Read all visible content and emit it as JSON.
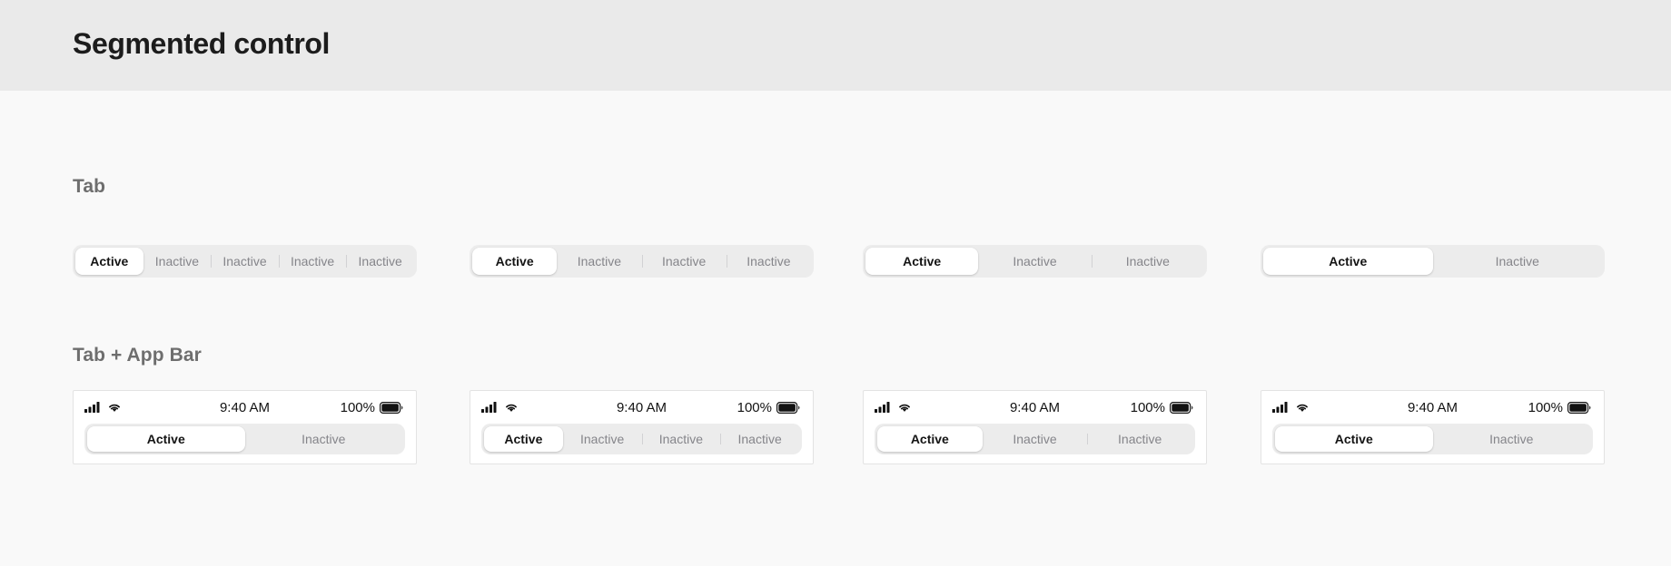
{
  "header": {
    "title": "Segmented control",
    "background": "#eaeaea"
  },
  "canvas": {
    "background": "#f9f9f9"
  },
  "sections": {
    "tab": {
      "label": "Tab"
    },
    "tab_app_bar": {
      "label": "Tab + App Bar"
    }
  },
  "colors": {
    "track": "#ececec",
    "thumb": "#ffffff",
    "active_text": "#141414",
    "inactive_text": "#85858a",
    "divider": "#d2d2d4",
    "section_label": "#6e6e6e",
    "card_border": "#e3e3e3"
  },
  "labels": {
    "active": "Active",
    "inactive": "Inactive"
  },
  "tab_row": {
    "controls": [
      {
        "name": "five-segment-control",
        "segments": [
          {
            "label": "Active",
            "state": "active"
          },
          {
            "label": "Inactive",
            "state": "inactive"
          },
          {
            "label": "Inactive",
            "state": "inactive"
          },
          {
            "label": "Inactive",
            "state": "inactive"
          },
          {
            "label": "Inactive",
            "state": "inactive"
          }
        ]
      },
      {
        "name": "four-segment-control",
        "segments": [
          {
            "label": "Active",
            "state": "active"
          },
          {
            "label": "Inactive",
            "state": "inactive"
          },
          {
            "label": "Inactive",
            "state": "inactive"
          },
          {
            "label": "Inactive",
            "state": "inactive"
          }
        ]
      },
      {
        "name": "three-segment-control",
        "segments": [
          {
            "label": "Active",
            "state": "active"
          },
          {
            "label": "Inactive",
            "state": "inactive"
          },
          {
            "label": "Inactive",
            "state": "inactive"
          }
        ]
      },
      {
        "name": "two-segment-control",
        "segments": [
          {
            "label": "Active",
            "state": "active"
          },
          {
            "label": "Inactive",
            "state": "inactive"
          }
        ]
      }
    ]
  },
  "app_bar_row": {
    "status_bar": {
      "time": "9:40 AM",
      "battery_percent": "100%",
      "icons": [
        "signal-bars-icon",
        "wifi-icon",
        "battery-icon"
      ]
    },
    "cards": [
      {
        "name": "app-bar-card-two-segments",
        "segments": [
          {
            "label": "Active",
            "state": "active"
          },
          {
            "label": "Inactive",
            "state": "inactive"
          }
        ]
      },
      {
        "name": "app-bar-card-four-segments",
        "segments": [
          {
            "label": "Active",
            "state": "active"
          },
          {
            "label": "Inactive",
            "state": "inactive"
          },
          {
            "label": "Inactive",
            "state": "inactive"
          },
          {
            "label": "Inactive",
            "state": "inactive"
          }
        ]
      },
      {
        "name": "app-bar-card-three-segments",
        "segments": [
          {
            "label": "Active",
            "state": "active"
          },
          {
            "label": "Inactive",
            "state": "inactive"
          },
          {
            "label": "Inactive",
            "state": "inactive"
          }
        ]
      },
      {
        "name": "app-bar-card-two-segments-wide",
        "segments": [
          {
            "label": "Active",
            "state": "active"
          },
          {
            "label": "Inactive",
            "state": "inactive"
          }
        ]
      }
    ]
  }
}
